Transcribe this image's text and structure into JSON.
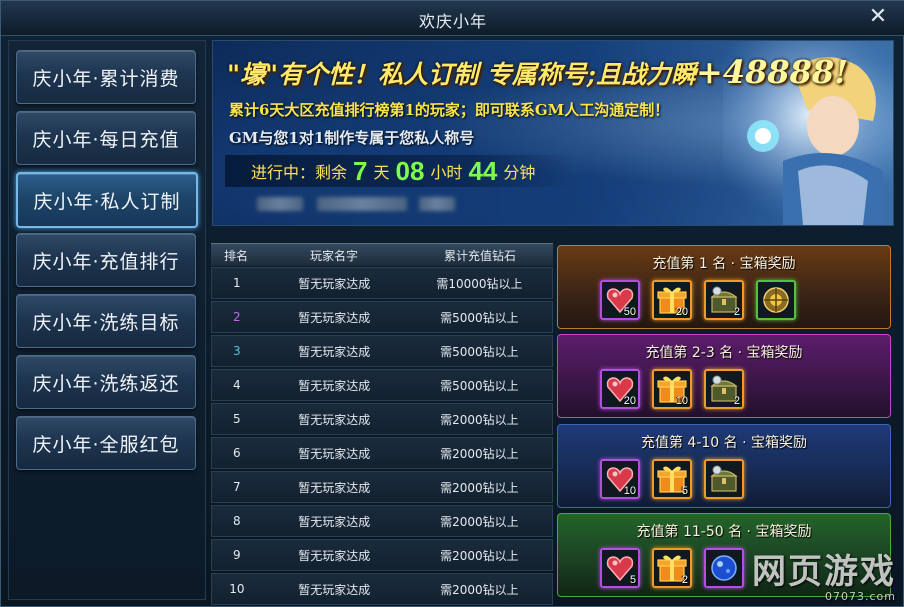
{
  "window": {
    "title": "欢庆小年",
    "close_glyph": "✕"
  },
  "sidebar": {
    "items": [
      {
        "label": "庆小年·累计消费",
        "active": false
      },
      {
        "label": "庆小年·每日充值",
        "active": false
      },
      {
        "label": "庆小年·私人订制",
        "active": true
      },
      {
        "label": "庆小年·充值排行",
        "active": false
      },
      {
        "label": "庆小年·洗练目标",
        "active": false
      },
      {
        "label": "庆小年·洗练返还",
        "active": false
      },
      {
        "label": "庆小年·全服红包",
        "active": false
      }
    ]
  },
  "banner": {
    "headline_open": "\"壕\"",
    "headline_mid": "有个性！私人订制 专属称号;且战力瞬",
    "headline_power": "+48888!",
    "line1": "累计6天大区充值排行榜第1的玩家；即可联系GM人工沟通定制！",
    "line2": "GM与您1对1制作专属于您私人称号",
    "countdown": {
      "prefix": "进行中：剩余",
      "days": "7",
      "days_unit": "天",
      "hours": "08",
      "hours_unit": "小时",
      "minutes": "44",
      "minutes_unit": "分钟"
    }
  },
  "rank_table": {
    "headers": [
      "排名",
      "玩家名字",
      "累计充值钻石"
    ],
    "rows": [
      {
        "rank": "1",
        "player": "暂无玩家达成",
        "req": "需10000钻以上"
      },
      {
        "rank": "2",
        "player": "暂无玩家达成",
        "req": "需5000钻以上"
      },
      {
        "rank": "3",
        "player": "暂无玩家达成",
        "req": "需5000钻以上"
      },
      {
        "rank": "4",
        "player": "暂无玩家达成",
        "req": "需5000钻以上"
      },
      {
        "rank": "5",
        "player": "暂无玩家达成",
        "req": "需2000钻以上"
      },
      {
        "rank": "6",
        "player": "暂无玩家达成",
        "req": "需2000钻以上"
      },
      {
        "rank": "7",
        "player": "暂无玩家达成",
        "req": "需2000钻以上"
      },
      {
        "rank": "8",
        "player": "暂无玩家达成",
        "req": "需2000钻以上"
      },
      {
        "rank": "9",
        "player": "暂无玩家达成",
        "req": "需2000钻以上"
      },
      {
        "rank": "10",
        "player": "暂无玩家达成",
        "req": "需2000钻以上"
      }
    ]
  },
  "rewards": [
    {
      "title": "充值第 1 名 · 宝箱奖励",
      "items": [
        {
          "icon": "heart-gem-icon",
          "count": "50",
          "quality": "purple"
        },
        {
          "icon": "gift-box-icon",
          "count": "20",
          "quality": "orange"
        },
        {
          "icon": "treasure-chest-icon",
          "count": "2",
          "quality": "orange"
        },
        {
          "icon": "gold-chest-icon",
          "count": "",
          "quality": "green"
        }
      ]
    },
    {
      "title": "充值第 2-3 名 · 宝箱奖励",
      "items": [
        {
          "icon": "heart-gem-icon",
          "count": "20",
          "quality": "purple"
        },
        {
          "icon": "gift-box-icon",
          "count": "10",
          "quality": "orange"
        },
        {
          "icon": "treasure-chest-icon",
          "count": "2",
          "quality": "orange"
        }
      ]
    },
    {
      "title": "充值第 4-10 名 · 宝箱奖励",
      "items": [
        {
          "icon": "heart-gem-icon",
          "count": "10",
          "quality": "purple"
        },
        {
          "icon": "gift-box-icon",
          "count": "5",
          "quality": "orange"
        },
        {
          "icon": "treasure-chest-icon",
          "count": "",
          "quality": "orange"
        }
      ]
    },
    {
      "title": "充值第 11-50 名 · 宝箱奖励",
      "items": [
        {
          "icon": "heart-gem-icon",
          "count": "5",
          "quality": "purple"
        },
        {
          "icon": "gift-box-icon",
          "count": "2",
          "quality": "orange"
        },
        {
          "icon": "blue-orb-icon",
          "count": "",
          "quality": "purple"
        }
      ]
    }
  ],
  "watermark": {
    "big": "网页游戏",
    "small": "07073.com"
  },
  "colors": {
    "accent": "#78b8e8",
    "headline": "#ffe86a",
    "countdown_number": "#7dff4a",
    "rank2": "#c06ae8",
    "rank3": "#4fc7e0"
  }
}
